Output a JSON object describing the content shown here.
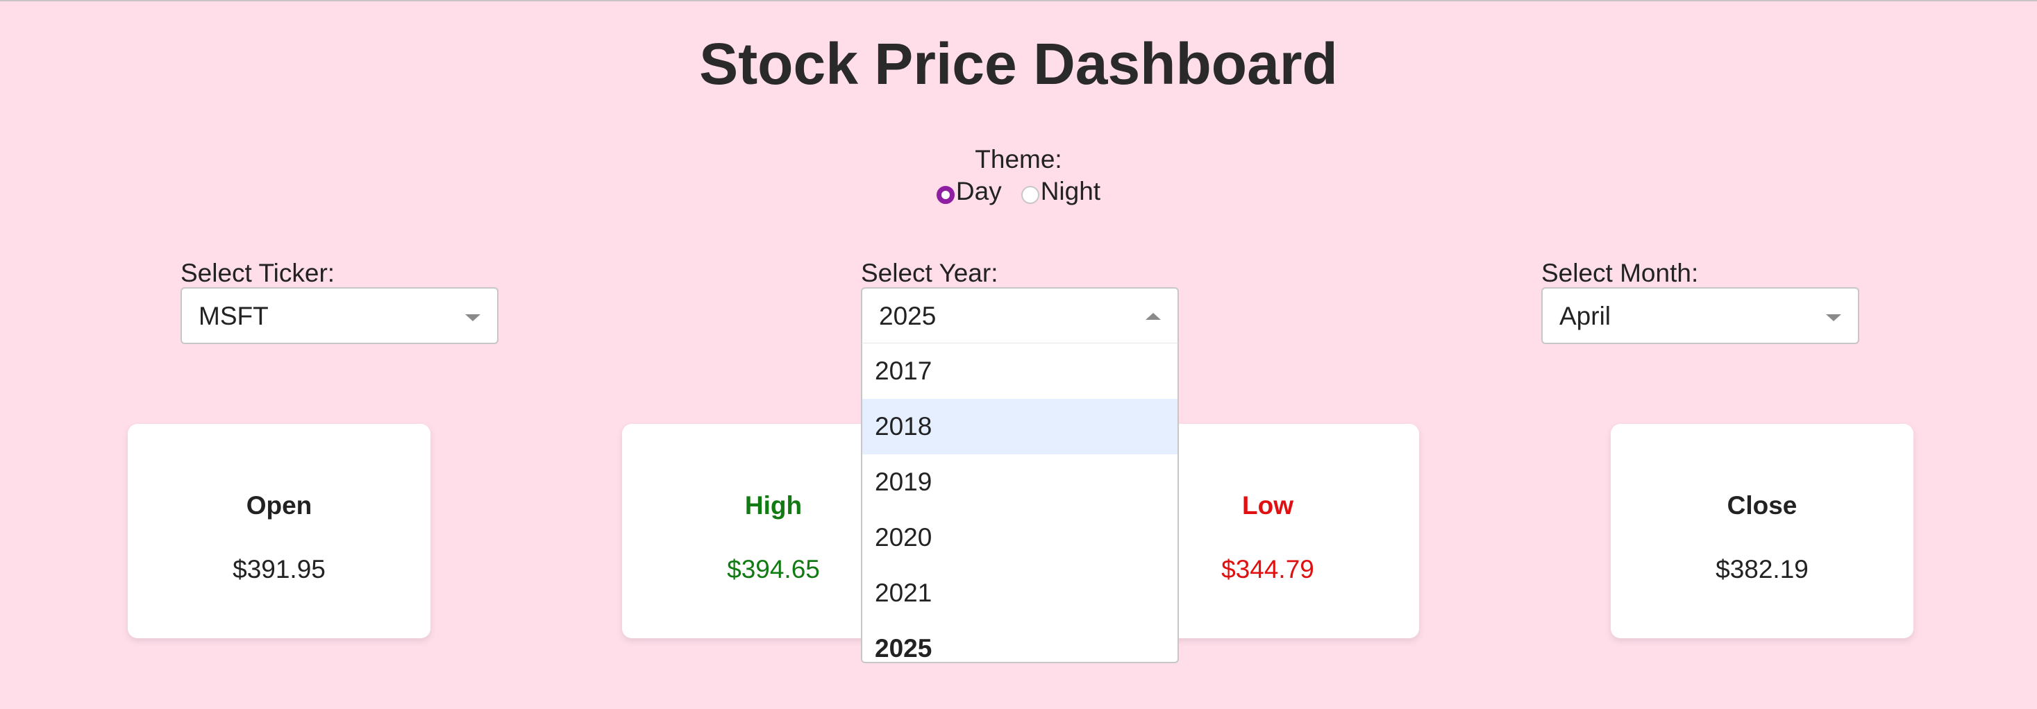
{
  "header": {
    "title": "Stock Price Dashboard"
  },
  "theme": {
    "label": "Theme:",
    "options": [
      {
        "label": "Day",
        "checked": true
      },
      {
        "label": "Night",
        "checked": false
      }
    ]
  },
  "ticker": {
    "label": "Select Ticker:",
    "value": "MSFT"
  },
  "year": {
    "label": "Select Year:",
    "value": "2025",
    "open": true,
    "options": [
      "2017",
      "2018",
      "2019",
      "2020",
      "2021",
      "2025"
    ],
    "highlighted": "2018"
  },
  "month": {
    "label": "Select Month:",
    "value": "April"
  },
  "cards": [
    {
      "title": "Open",
      "value": "$391.95",
      "color": "#222222"
    },
    {
      "title": "High",
      "value": "$394.65",
      "color": "#127a12"
    },
    {
      "title": "Low",
      "value": "$344.79",
      "color": "#e01010"
    },
    {
      "title": "Close",
      "value": "$382.19",
      "color": "#222222"
    }
  ],
  "colors": {
    "background": "#ffdeea",
    "radio_accent": "#8e1fa1",
    "highlight": "#e5efff"
  },
  "icons": {
    "select_arrow": "chevron-down-icon",
    "select_arrow_open": "chevron-up-icon"
  }
}
